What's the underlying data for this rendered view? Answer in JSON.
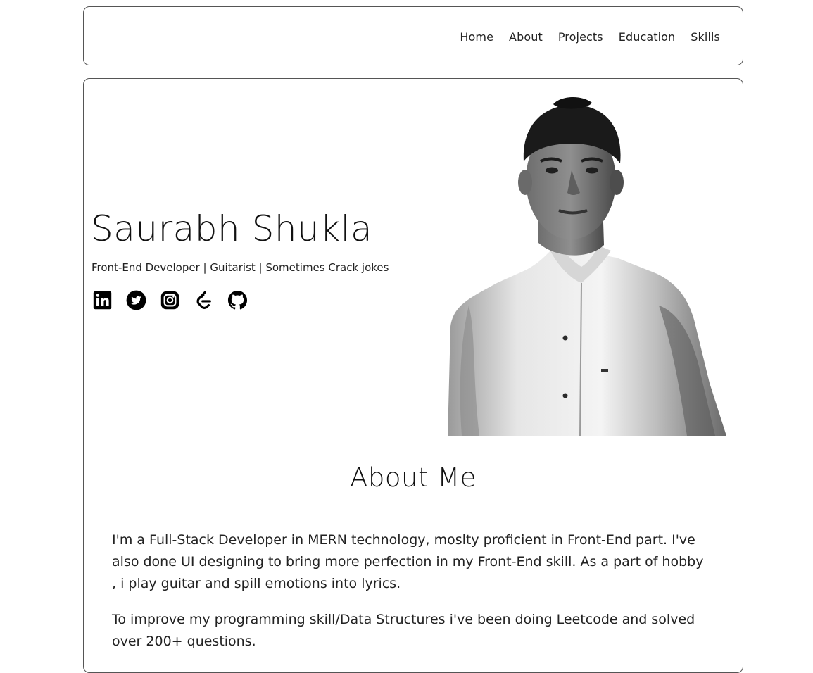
{
  "nav": {
    "items": [
      {
        "label": "Home"
      },
      {
        "label": "About"
      },
      {
        "label": "Projects"
      },
      {
        "label": "Education"
      },
      {
        "label": "Skills"
      }
    ]
  },
  "hero": {
    "name": "Saurabh Shukla",
    "tagline": "Front-End Developer | Guitarist | Sometimes Crack jokes",
    "social_icons": [
      "linkedin-icon",
      "twitter-icon",
      "instagram-icon",
      "leetcode-icon",
      "github-icon"
    ],
    "portrait": "grayscale-portrait-photo"
  },
  "about": {
    "title": "About Me",
    "paragraphs": [
      "I'm a Full-Stack Developer in MERN technology, moslty proficient in Front-End part. I've also done UI designing to bring more perfection in my Front-End skill. As a part of hobby , i play guitar and spill emotions into lyrics.",
      "To improve my programming skill/Data Structures i've been doing Leetcode and solved over 200+ questions."
    ]
  },
  "colors": {
    "border": "#555555",
    "text": "#111111",
    "background": "#ffffff"
  }
}
